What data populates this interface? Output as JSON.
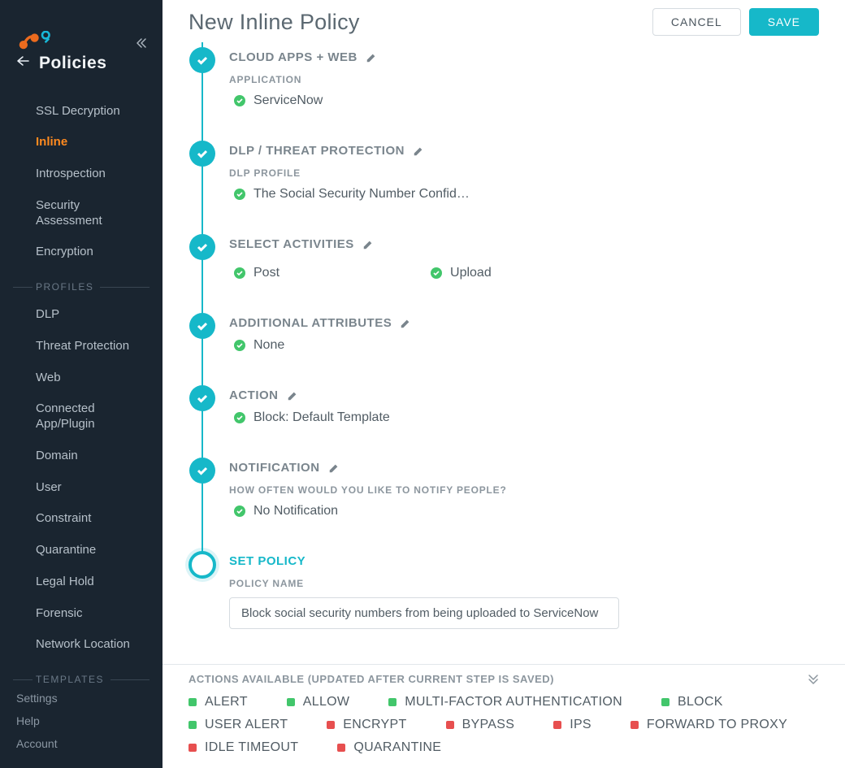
{
  "header": {
    "title": "New Inline Policy",
    "cancel": "CANCEL",
    "save": "SAVE"
  },
  "sidebar": {
    "section_title": "Policies",
    "nav": [
      {
        "label": "SSL Decryption",
        "active": false
      },
      {
        "label": "Inline",
        "active": true
      },
      {
        "label": "Introspection",
        "active": false
      },
      {
        "label": "Security Assessment",
        "active": false
      },
      {
        "label": "Encryption",
        "active": false
      }
    ],
    "profiles_label": "PROFILES",
    "profiles": [
      {
        "label": "DLP"
      },
      {
        "label": "Threat Protection"
      },
      {
        "label": "Web"
      },
      {
        "label": "Connected App/Plugin"
      },
      {
        "label": "Domain"
      },
      {
        "label": "User"
      },
      {
        "label": "Constraint"
      },
      {
        "label": "Quarantine"
      },
      {
        "label": "Legal Hold"
      },
      {
        "label": "Forensic"
      },
      {
        "label": "Network Location"
      }
    ],
    "templates_label": "TEMPLATES",
    "footer": {
      "settings": "Settings",
      "help": "Help",
      "account": "Account"
    }
  },
  "wizard": {
    "steps": [
      {
        "title": "CLOUD APPS + WEB",
        "sub_label": "APPLICATION",
        "values": [
          "ServiceNow"
        ]
      },
      {
        "title": "DLP / THREAT PROTECTION",
        "sub_label": "DLP PROFILE",
        "values": [
          "The Social Security Number Confid…"
        ]
      },
      {
        "title": "SELECT ACTIVITIES",
        "two_col_values": [
          "Post",
          "Upload"
        ]
      },
      {
        "title": "ADDITIONAL ATTRIBUTES",
        "values": [
          "None"
        ]
      },
      {
        "title": "ACTION",
        "values": [
          "Block: Default Template"
        ]
      },
      {
        "title": "NOTIFICATION",
        "sub_label": "HOW OFTEN WOULD YOU LIKE TO NOTIFY PEOPLE?",
        "values": [
          "No Notification"
        ]
      },
      {
        "title": "SET POLICY",
        "active": true,
        "sub_label": "POLICY NAME",
        "input_value": "Block social security numbers from being uploaded to ServiceNow"
      }
    ]
  },
  "actions_footer": {
    "header": "ACTIONS AVAILABLE (UPDATED AFTER CURRENT STEP IS SAVED)",
    "items": [
      {
        "label": "ALERT",
        "color": "green"
      },
      {
        "label": "ALLOW",
        "color": "green"
      },
      {
        "label": "MULTI-FACTOR AUTHENTICATION",
        "color": "green"
      },
      {
        "label": "BLOCK",
        "color": "green"
      },
      {
        "label": "USER ALERT",
        "color": "green"
      },
      {
        "label": "ENCRYPT",
        "color": "red"
      },
      {
        "label": "BYPASS",
        "color": "red"
      },
      {
        "label": "IPS",
        "color": "red"
      },
      {
        "label": "FORWARD TO PROXY",
        "color": "red"
      },
      {
        "label": "IDLE TIMEOUT",
        "color": "red"
      },
      {
        "label": "QUARANTINE",
        "color": "red"
      }
    ]
  }
}
